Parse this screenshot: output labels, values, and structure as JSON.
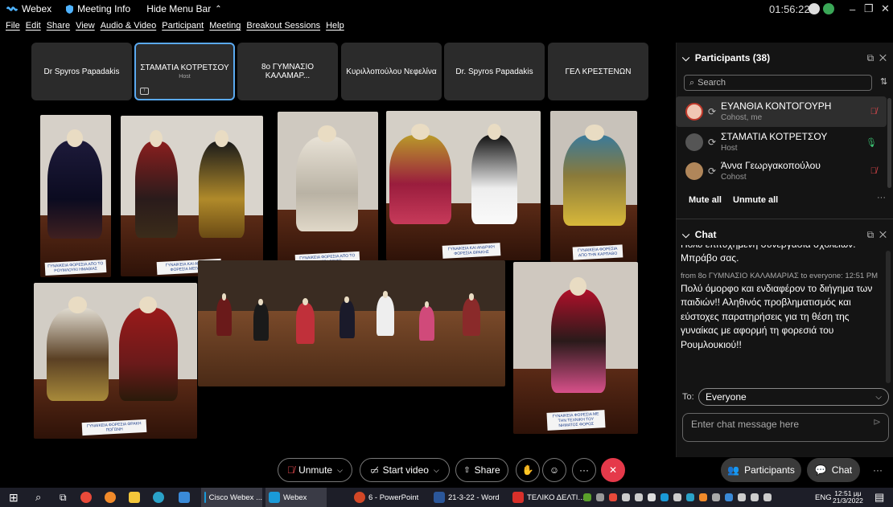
{
  "titlebar": {
    "app": "Webex",
    "meeting_info": "Meeting Info",
    "hide_menu": "Hide Menu Bar",
    "clock": "01:56:22"
  },
  "menu": [
    "File",
    "Edit",
    "Share",
    "View",
    "Audio & Video",
    "Participant",
    "Meeting",
    "Breakout Sessions",
    "Help"
  ],
  "tiles": [
    {
      "name": "Dr Spyros Papadakis",
      "sub": ""
    },
    {
      "name": "ΣΤΑΜΑΤΙΑ ΚΟΤΡΕΤΣΟΥ",
      "sub": "Host"
    },
    {
      "name": "8ο ΓΥΜΝΑΣΙΟ ΚΑΛΑΜΑΡ...",
      "sub": ""
    },
    {
      "name": "Κυριλλοπούλου Νεφελίνα",
      "sub": ""
    },
    {
      "name": "Dr. Spyros Papadakis",
      "sub": ""
    },
    {
      "name": "ΓΕΛ ΚΡΕΣΤΕΝΩΝ",
      "sub": ""
    }
  ],
  "photo_cards": [
    "ΓΥΝΑΙΚΕΙΑ ΦΟΡΕΣΙΑ ΑΠΟ ΤΟ ΡΟΥΜΛΟΥΚΙ ΗΜΑΘΙΑΣ",
    "ΓΥΝΑΙΚΕΙΑ ΚΑΙ ΑΝΔΡΙΚΗ ΦΟΡΕΣΙΑ ΜΕΓΑΡΩΝ",
    "ΓΥΝΑΙΚΕΙΑ ΦΟΡΕΣΙΑ ΑΠΟ ΤΟ ΚΑΣΤΕΛΟΡΙΖΟ",
    "ΓΥΝΑΙΚΕΙΑ ΚΑΙ ΑΝΔΡΙΚΗ ΦΟΡΕΣΙΑ ΘΡΑΚΗΣ",
    "ΓΥΝΑΙΚΕΙΑ ΦΟΡΕΣΙΑ ΑΠΟ ΤΗΝ ΚΑΡΠΑΘΟ",
    "ΓΥΝΑΙΚΕΙΑ ΦΟΡΕΣΙΑ ΘΡΑΚΗ ΠΩΓΩΝΗ",
    "ΓΥΝΑΙΚΕΙΑ ΦΟΡΕΣΙΑ ΜΕ ΤΗΝ ΤΕΧΝΙΚΗ ΤΟΥ ΝΗΜΑΤΟΣ ΦΟΡΟΣ"
  ],
  "participants": {
    "header": "Participants (38)",
    "search_placeholder": "Search",
    "list": [
      {
        "name": "ΕΥΑΝΘΙΑ ΚΟΝΤΟΓΟΥΡΗ",
        "role": "Cohost, me",
        "mic": "muted"
      },
      {
        "name": "ΣΤΑΜΑΤΙΑ ΚΟΤΡΕΤΣΟΥ",
        "role": "Host",
        "mic": "active"
      },
      {
        "name": "Άννα Γεωργακοπούλου",
        "role": "Cohost",
        "mic": "muted"
      }
    ],
    "mute_all": "Mute all",
    "unmute_all": "Unmute all"
  },
  "chat": {
    "header": "Chat",
    "prev_msg_tail_1": "Πολύ επιτυχημένη συνεργασία σχολείων.",
    "prev_msg_tail_2": "Μπράβο σας.",
    "meta": "from 8ο ΓΥΜΝΑΣΙΟ ΚΑΛΑΜΑΡΙΑΣ to everyone:   12:51 PM",
    "message": "Πολύ όμορφο και ενδιαφέρον το διήγημα των παιδιών!! Αληθινός προβληματισμός και εύστοχες παρατηρήσεις για τη θέση της γυναίκας με αφορμή τη φορεσιά του Ρουμλουκιού!!",
    "to_label": "To:",
    "to_value": "Everyone",
    "input_placeholder": "Enter chat message here"
  },
  "controls": {
    "unmute": "Unmute",
    "start_video": "Start video",
    "share": "Share",
    "participants": "Participants",
    "chat": "Chat"
  },
  "taskbar": {
    "apps": [
      "Cisco Webex ...",
      "Webex",
      "6 - PowerPoint",
      "21-3-22 - Word",
      "ΤΕΛΙΚΟ ΔΕΛΤΙ..."
    ],
    "lang": "ENG",
    "time": "12:51 μμ",
    "date": "21/3/2022"
  }
}
